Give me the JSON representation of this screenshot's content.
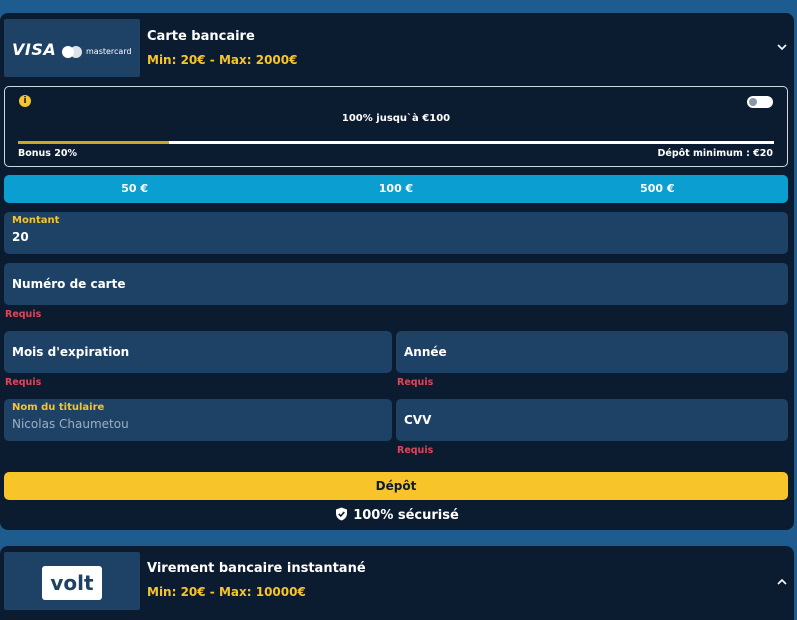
{
  "card_method": {
    "logo_visa": "VISA",
    "logo_mastercard": "mastercard",
    "title": "Carte bancaire",
    "limits": "Min: 20€ - Max: 2000€"
  },
  "bonus": {
    "headline": "100% jusqu`à €100",
    "bonus_label": "Bonus 20%",
    "min_deposit": "Dépôt minimum : €20",
    "progress_fraction": 0.2,
    "toggle_on": false
  },
  "quick_amounts": [
    "50 €",
    "100 €",
    "500 €"
  ],
  "form": {
    "amount": {
      "label": "Montant",
      "value": "20"
    },
    "card_number": {
      "label": "Numéro de carte",
      "error": "Requis"
    },
    "exp_month": {
      "label": "Mois d'expiration",
      "error": "Requis"
    },
    "exp_year": {
      "label": "Année",
      "error": "Requis"
    },
    "holder": {
      "label": "Nom du titulaire",
      "placeholder": "Nicolas Chaumetou"
    },
    "cvv": {
      "label": "CVV",
      "error": "Requis"
    }
  },
  "deposit_button": "Dépôt",
  "secure_text": "100% sécurisé",
  "transfer_method": {
    "logo": "volt",
    "title": "Virement bancaire instantané",
    "limits": "Min: 20€ - Max: 10000€"
  },
  "colors": {
    "page_bg": "#1e5b8e",
    "card_bg": "#0c1c30",
    "field_bg": "#1d4266",
    "accent_yellow": "#f7c52a",
    "quick_amount_bg": "#0a9fd0",
    "error_red": "#e0455a"
  }
}
